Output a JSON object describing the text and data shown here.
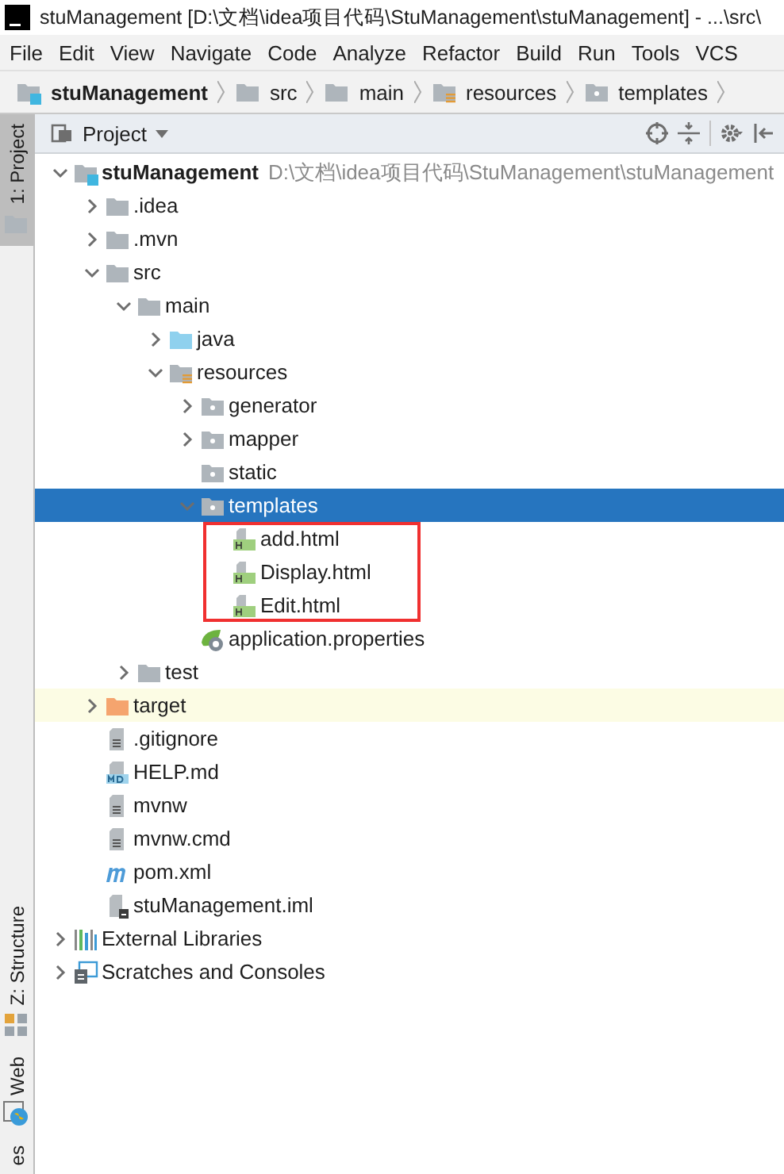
{
  "window": {
    "title": "stuManagement [D:\\文档\\idea项目代码\\StuManagement\\stuManagement] - ...\\src\\"
  },
  "menu": [
    "File",
    "Edit",
    "View",
    "Navigate",
    "Code",
    "Analyze",
    "Refactor",
    "Build",
    "Run",
    "Tools",
    "VCS"
  ],
  "breadcrumbs": [
    {
      "label": "stuManagement",
      "kind": "module"
    },
    {
      "label": "src",
      "kind": "folder"
    },
    {
      "label": "main",
      "kind": "folder"
    },
    {
      "label": "resources",
      "kind": "resources"
    },
    {
      "label": "templates",
      "kind": "package"
    }
  ],
  "left_tabs": [
    {
      "label": "1: Project",
      "selected": true,
      "kind": "folder"
    },
    {
      "label": "Z: Structure",
      "selected": false,
      "kind": "structure"
    },
    {
      "label": "Web",
      "selected": false,
      "kind": "web"
    },
    {
      "label": "es",
      "selected": false
    }
  ],
  "panel": {
    "title": "Project"
  },
  "tree": [
    {
      "label": "stuManagement",
      "path": "D:\\文档\\idea项目代码\\StuManagement\\stuManagement",
      "kind": "module",
      "expanded": true,
      "selected": false,
      "highlighted": false,
      "children": [
        {
          "label": ".idea",
          "kind": "folder",
          "expanded": false,
          "selected": false,
          "highlighted": false
        },
        {
          "label": ".mvn",
          "kind": "folder",
          "expanded": false,
          "selected": false,
          "highlighted": false
        },
        {
          "label": "src",
          "kind": "folder",
          "expanded": true,
          "selected": false,
          "highlighted": false,
          "children": [
            {
              "label": "main",
              "kind": "folder",
              "expanded": true,
              "selected": false,
              "highlighted": false,
              "children": [
                {
                  "label": "java",
                  "kind": "source",
                  "expanded": false,
                  "selected": false,
                  "highlighted": false
                },
                {
                  "label": "resources",
                  "kind": "resources",
                  "expanded": true,
                  "selected": false,
                  "highlighted": false,
                  "children": [
                    {
                      "label": "generator",
                      "kind": "package",
                      "expanded": false,
                      "selected": false,
                      "highlighted": false
                    },
                    {
                      "label": "mapper",
                      "kind": "package",
                      "expanded": false,
                      "selected": false,
                      "highlighted": false
                    },
                    {
                      "label": "static",
                      "kind": "package",
                      "selected": false,
                      "highlighted": false
                    },
                    {
                      "label": "templates",
                      "kind": "package",
                      "expanded": true,
                      "selected": true,
                      "highlighted": false,
                      "children_boxed": true,
                      "children": [
                        {
                          "label": "add.html",
                          "kind": "html",
                          "selected": false,
                          "highlighted": false
                        },
                        {
                          "label": "Display.html",
                          "kind": "html",
                          "selected": false,
                          "highlighted": false
                        },
                        {
                          "label": "Edit.html",
                          "kind": "html",
                          "selected": false,
                          "highlighted": false
                        }
                      ]
                    },
                    {
                      "label": "application.properties",
                      "kind": "properties",
                      "selected": false,
                      "highlighted": false
                    }
                  ]
                }
              ]
            },
            {
              "label": "test",
              "kind": "folder",
              "expanded": false,
              "selected": false,
              "highlighted": false
            }
          ]
        },
        {
          "label": "target",
          "kind": "excluded",
          "expanded": false,
          "selected": false,
          "highlighted": true
        },
        {
          "label": ".gitignore",
          "kind": "text",
          "selected": false,
          "highlighted": false
        },
        {
          "label": "HELP.md",
          "kind": "markdown",
          "selected": false,
          "highlighted": false
        },
        {
          "label": "mvnw",
          "kind": "text",
          "selected": false,
          "highlighted": false
        },
        {
          "label": "mvnw.cmd",
          "kind": "text",
          "selected": false,
          "highlighted": false
        },
        {
          "label": "pom.xml",
          "kind": "maven",
          "selected": false,
          "highlighted": false
        },
        {
          "label": "stuManagement.iml",
          "kind": "iml",
          "selected": false,
          "highlighted": false
        }
      ]
    },
    {
      "label": "External Libraries",
      "kind": "libraries",
      "expanded": false,
      "selected": false,
      "highlighted": false
    },
    {
      "label": "Scratches and Consoles",
      "kind": "scratches",
      "expanded": false,
      "selected": false,
      "highlighted": false
    }
  ]
}
